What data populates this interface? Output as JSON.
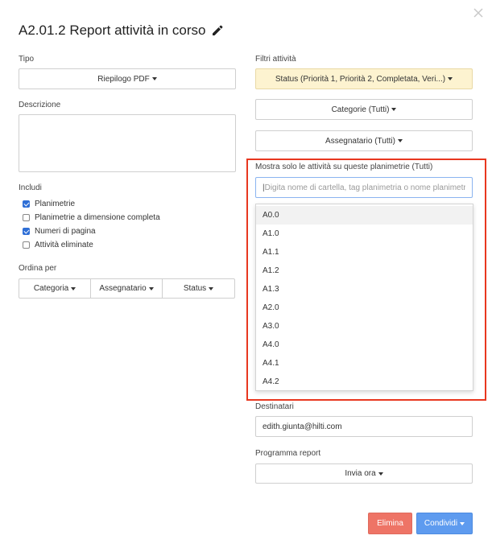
{
  "dialog": {
    "title": "A2.01.2 Report attività in corso"
  },
  "type": {
    "label": "Tipo",
    "value": "Riepilogo PDF"
  },
  "description": {
    "label": "Descrizione",
    "value": ""
  },
  "includes": {
    "label": "Includi",
    "items": [
      {
        "label": "Planimetrie",
        "checked": true
      },
      {
        "label": "Planimetrie a dimensione completa",
        "checked": false
      },
      {
        "label": "Numeri di pagina",
        "checked": true
      },
      {
        "label": "Attività eliminate",
        "checked": false
      }
    ]
  },
  "sort": {
    "label": "Ordina per",
    "options": [
      "Categoria",
      "Assegnatario",
      "Status"
    ]
  },
  "filters": {
    "label": "Filtri attività",
    "status": "Status (Priorità 1, Priorità 2, Completata, Veri...)",
    "categories": "Categorie (Tutti)",
    "assignee": "Assegnatario (Tutti)"
  },
  "plans": {
    "label": "Mostra solo le attività su queste planimetrie (Tutti)",
    "placeholder": "Digita nome di cartella, tag planimetria o nome planimetria",
    "options": [
      "A0.0",
      "A1.0",
      "A1.1",
      "A1.2",
      "A1.3",
      "A2.0",
      "A3.0",
      "A4.0",
      "A4.1",
      "A4.2"
    ]
  },
  "recipients": {
    "label": "Destinatari",
    "value": "edith.giunta@hilti.com"
  },
  "schedule": {
    "label": "Programma report",
    "value": "Invia ora"
  },
  "actions": {
    "delete": "Elimina",
    "share": "Condividi"
  },
  "colors": {
    "highlight": "#e8371f",
    "delete": "#ee7466",
    "share": "#5e9bef",
    "status_filter": "#fdf3d0"
  }
}
